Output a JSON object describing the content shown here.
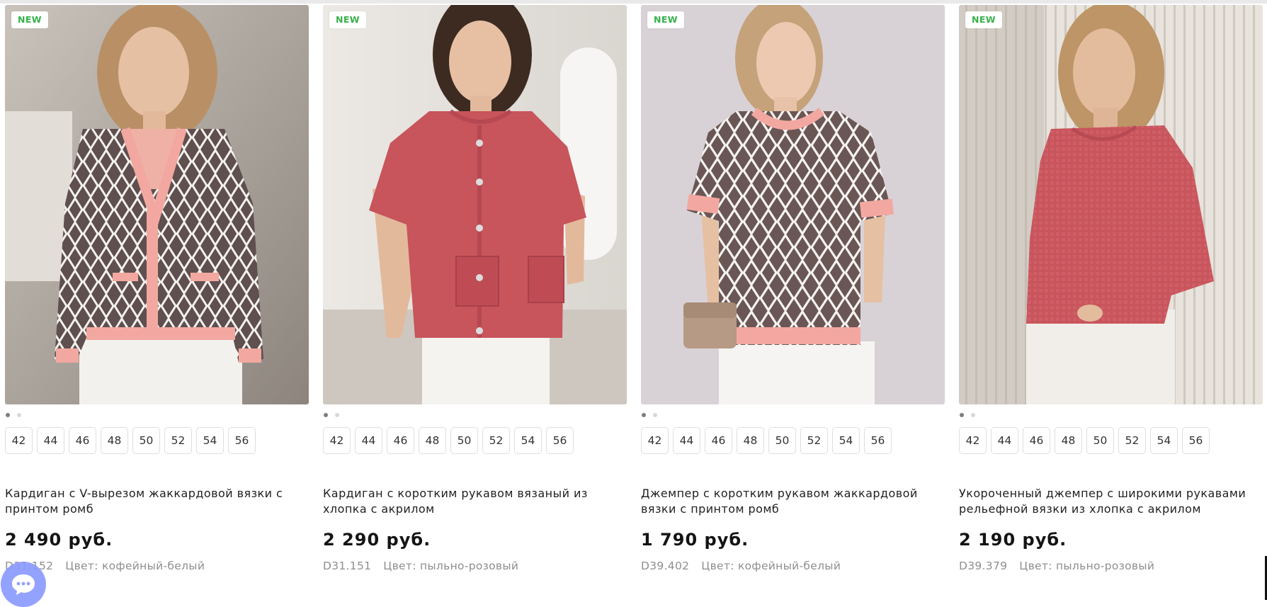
{
  "badge_label": "NEW",
  "products": [
    {
      "title": "Кардиган с V-вырезом жаккардовой вязки с принтом ромб",
      "price": "2 490 руб.",
      "article": "D31.152",
      "color": "Цвет: кофейный-белый",
      "sizes": [
        "42",
        "44",
        "46",
        "48",
        "50",
        "52",
        "54",
        "56"
      ],
      "garment": "cardigan-pattern"
    },
    {
      "title": "Кардиган с коротким рукавом вязаный из хлопка с акрилом",
      "price": "2 290 руб.",
      "article": "D31.151",
      "color": "Цвет: пыльно-розовый",
      "sizes": [
        "42",
        "44",
        "46",
        "48",
        "50",
        "52",
        "54",
        "56"
      ],
      "garment": "cardigan-rose"
    },
    {
      "title": "Джемпер с коротким рукавом жаккардовой вязки с принтом ромб",
      "price": "1 790 руб.",
      "article": "D39.402",
      "color": "Цвет: кофейный-белый",
      "sizes": [
        "42",
        "44",
        "46",
        "48",
        "50",
        "52",
        "54",
        "56"
      ],
      "garment": "jumper-pattern"
    },
    {
      "title": "Укороченный джемпер с широкими рукавами рельефной вязки из хлопка с акрилом",
      "price": "2 190 руб.",
      "article": "D39.379",
      "color": "Цвет: пыльно-розовый",
      "sizes": [
        "42",
        "44",
        "46",
        "48",
        "50",
        "52",
        "54",
        "56"
      ],
      "garment": "jumper-rose"
    }
  ],
  "colors": {
    "badge_text": "#36b24a",
    "rose": "#c8545c",
    "pink_trim": "#f0a4a0",
    "coffee": "#6d5a58",
    "chat_button": "#8c9bff"
  },
  "icons": {
    "chat": "chat-bubble-icon"
  }
}
